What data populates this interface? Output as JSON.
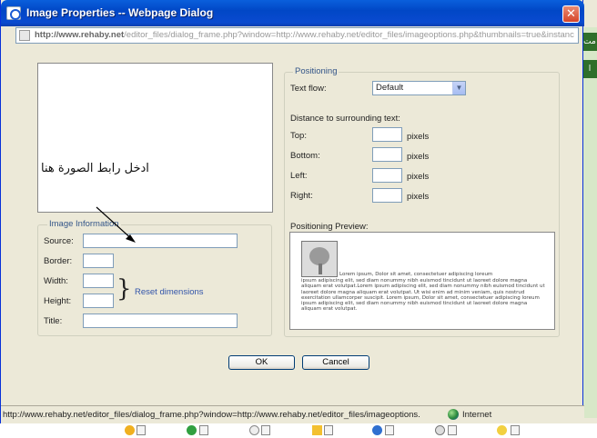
{
  "window": {
    "title": "Image Properties -- Webpage Dialog",
    "close_glyph": "✕",
    "address_host": "http://www.rehaby.net",
    "address_rest": "/editor_files/dialog_frame.php?window=http://www.rehaby.net/editor_files/imageoptions.php&thumbnails=true&instanc"
  },
  "annotation": {
    "text": "ادخل رابط الصورة هنا"
  },
  "image_information": {
    "legend": "Image Information",
    "source_label": "Source:",
    "source_value": "",
    "border_label": "Border:",
    "border_value": "",
    "width_label": "Width:",
    "width_value": "",
    "height_label": "Height:",
    "height_value": "",
    "reset_label": "Reset dimensions",
    "title_label": "Title:",
    "title_value": ""
  },
  "positioning": {
    "legend": "Positioning",
    "text_flow_label": "Text flow:",
    "text_flow_value": "Default",
    "distance_label": "Distance to surrounding text:",
    "top_label": "Top:",
    "top_value": "",
    "bottom_label": "Bottom:",
    "bottom_value": "",
    "left_label": "Left:",
    "left_value": "",
    "right_label": "Right:",
    "right_value": "",
    "unit": "pixels",
    "preview_label": "Positioning Preview:",
    "lorem_first": "Lorem ipsum, Dolor sit amet, consectetuer adipiscing loreum",
    "lorem_body": "ipsum adipiscing elit, sed diam nonummy nibh euismod tincidunt ut laoreet dolore magna aliquam erat volutpat.Lorem ipsum adipiscing elit, sed diam nonummy nibh euismod tincidunt ut laoreet dolore magna aliquam erat volutpat. Ut wisi enim ad minim veniam, quis nostrud exercitation ullamcorper suscipit. Lorem ipsum, Dolor sit amet, consectetuer adipiscing loreum ipsum adipiscing elit, sed diam nonummy nibh euismod tincidunt ut laoreet dolore magna aliquam erat volutpat."
  },
  "buttons": {
    "ok": "OK",
    "cancel": "Cancel"
  },
  "statusbar": {
    "url": "http://www.rehaby.net/editor_files/dialog_frame.php?window=http://www.rehaby.net/editor_files/imageoptions.",
    "zone": "Internet"
  },
  "background": {
    "tab_top": "مت",
    "tab_bottom": "ا"
  }
}
